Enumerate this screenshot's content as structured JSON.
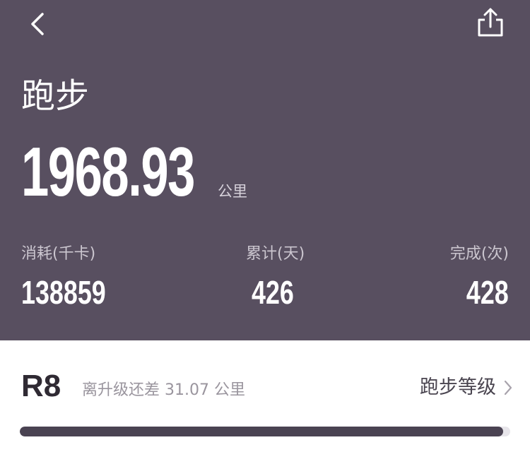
{
  "header": {
    "title": "跑步",
    "distance_value": "1968.93",
    "distance_unit": "公里",
    "background_color": "#584f60"
  },
  "stats": [
    {
      "label": "消耗(千卡)",
      "value": "138859"
    },
    {
      "label": "累计(天)",
      "value": "426"
    },
    {
      "label": "完成(次)",
      "value": "428"
    }
  ],
  "icons": {
    "back": "chevron-left-icon",
    "share": "share-icon",
    "chevron_right": "chevron-right-icon"
  },
  "level": {
    "badge": "R8",
    "remaining_text": "离升级还差 31.07 公里",
    "link_label": "跑步等级",
    "progress_fraction": 0.985,
    "progress_color": "#4a4352"
  }
}
